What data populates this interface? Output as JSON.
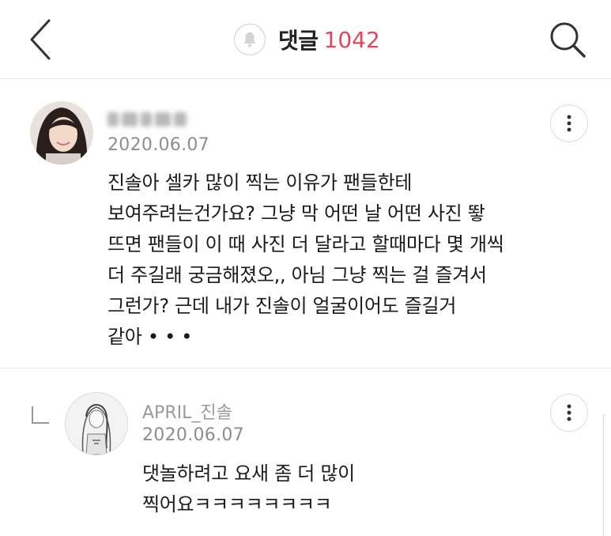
{
  "header": {
    "title": "댓글",
    "count": "1042"
  },
  "comments": [
    {
      "author": "",
      "date": "2020.06.07",
      "body": "진솔아 셀카 많이 찍는 이유가 팬들한테\n보여주려는건가요? 그냥 막 어떤 날 어떤 사진 뙇\n뜨면 팬들이 이 때 사진 더 달라고 할때마다 몇 개씩\n더 주길래 궁금해졌오,, 아님 그냥 찍는 걸 즐겨서\n그런가? 근데 내가 진솔이 얼굴이어도 즐길거\n같아 • • •"
    },
    {
      "author": "APRIL_진솔",
      "date": "2020.06.07",
      "body": "댓놀하려고 요새 좀 더 많이\n찍어요ㅋㅋㅋㅋㅋㅋㅋㅋ"
    }
  ],
  "icons": {
    "back": "chevron-left-icon",
    "notification": "bell-icon",
    "search": "search-icon",
    "more": "more-vertical-icon",
    "reply": "reply-corner-icon"
  },
  "colors": {
    "count_accent": "#e0475a",
    "meta_text": "#8e8e8e",
    "divider": "#e6e6e6"
  }
}
